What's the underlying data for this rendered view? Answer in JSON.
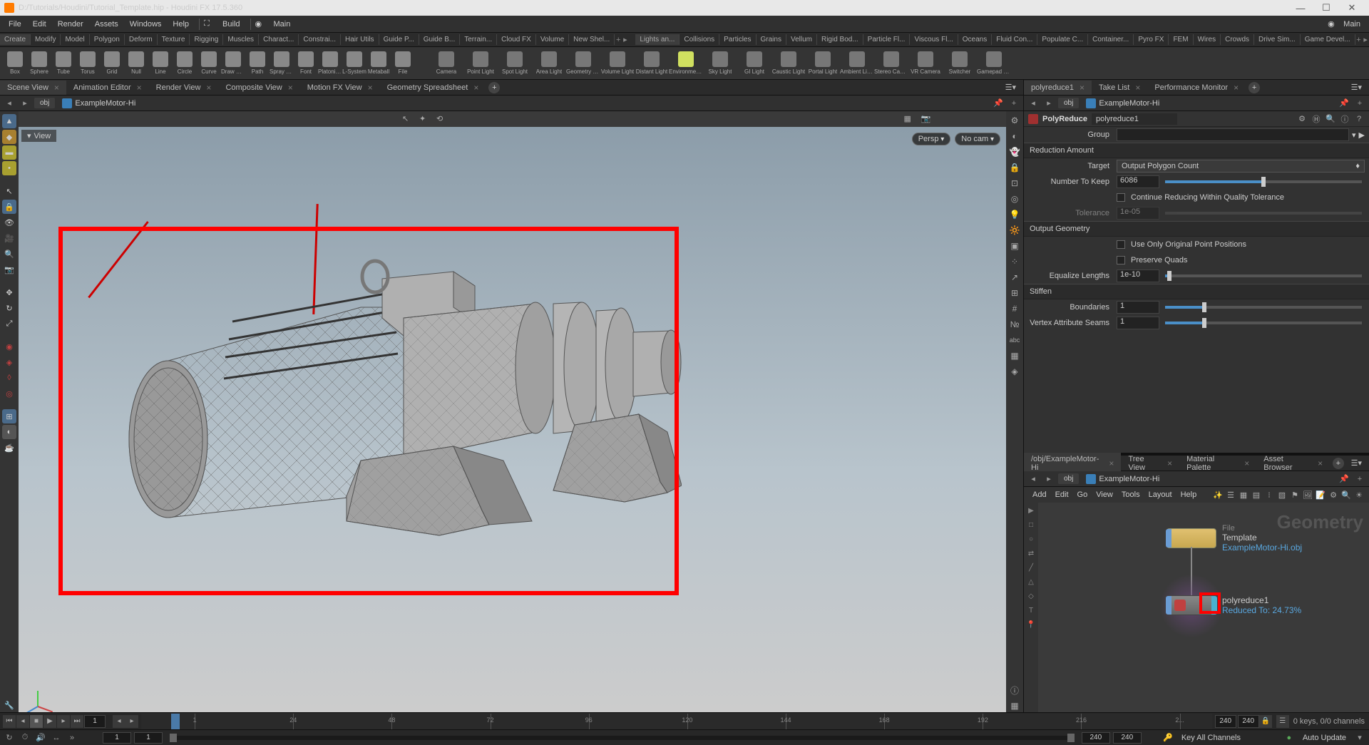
{
  "title": "D:/Tutorials/Houdini/Tutorial_Template.hip - Houdini FX 17.5.360",
  "menubar": {
    "items": [
      "File",
      "Edit",
      "Render",
      "Assets",
      "Windows",
      "Help"
    ],
    "build": "Build",
    "main": "Main"
  },
  "shelf_tabs_left": [
    "Create",
    "Modify",
    "Model",
    "Polygon",
    "Deform",
    "Texture",
    "Rigging",
    "Muscles",
    "Charact...",
    "Constrai...",
    "Hair Utils",
    "Guide P...",
    "Guide B...",
    "Terrain...",
    "Cloud FX",
    "Volume",
    "New Shel..."
  ],
  "shelf_tabs_right": [
    "Lights an...",
    "Collisions",
    "Particles",
    "Grains",
    "Vellum",
    "Rigid Bod...",
    "Particle Fl...",
    "Viscous Fl...",
    "Oceans",
    "Fluid Con...",
    "Populate C...",
    "Container...",
    "Pyro FX",
    "FEM",
    "Wires",
    "Crowds",
    "Drive Sim...",
    "Game Devel..."
  ],
  "tools_left": [
    {
      "label": "Box"
    },
    {
      "label": "Sphere"
    },
    {
      "label": "Tube"
    },
    {
      "label": "Torus"
    },
    {
      "label": "Grid"
    },
    {
      "label": "Null"
    },
    {
      "label": "Line"
    },
    {
      "label": "Circle"
    },
    {
      "label": "Curve"
    },
    {
      "label": "Draw Curve"
    },
    {
      "label": "Path"
    },
    {
      "label": "Spray Paint"
    },
    {
      "label": "Font"
    },
    {
      "label": "Platonic Solids"
    },
    {
      "label": "L-System"
    },
    {
      "label": "Metaball"
    },
    {
      "label": "File"
    }
  ],
  "tools_right": [
    {
      "label": "Camera"
    },
    {
      "label": "Point Light"
    },
    {
      "label": "Spot Light"
    },
    {
      "label": "Area Light"
    },
    {
      "label": "Geometry Light"
    },
    {
      "label": "Volume Light"
    },
    {
      "label": "Distant Light"
    },
    {
      "label": "Environment Light"
    },
    {
      "label": "Sky Light"
    },
    {
      "label": "GI Light"
    },
    {
      "label": "Caustic Light"
    },
    {
      "label": "Portal Light"
    },
    {
      "label": "Ambient Light"
    },
    {
      "label": "Stereo Camera"
    },
    {
      "label": "VR Camera"
    },
    {
      "label": "Switcher"
    },
    {
      "label": "Gamepad Camera"
    }
  ],
  "left_tabs": [
    "Scene View",
    "Animation Editor",
    "Render View",
    "Composite View",
    "Motion FX View",
    "Geometry Spreadsheet"
  ],
  "right_top_tabs": [
    "polyreduce1",
    "Take List",
    "Performance Monitor"
  ],
  "path": {
    "obj": "obj",
    "scene": "ExampleMotor-Hi"
  },
  "view": {
    "label": "View",
    "persp": "Persp",
    "nocam": "No cam"
  },
  "node": {
    "type": "PolyReduce",
    "name": "polyreduce1",
    "section_reduce": "Reduction Amount",
    "group_label": "Group",
    "group_value": "",
    "target_label": "Target",
    "target_value": "Output Polygon Count",
    "numkeep_label": "Number To Keep",
    "numkeep_value": "6086",
    "continue_label": "Continue Reducing Within Quality Tolerance",
    "tolerance_label": "Tolerance",
    "tolerance_value": "1e-05",
    "section_outgeo": "Output Geometry",
    "origpts_label": "Use Only Original Point Positions",
    "presquads_label": "Preserve Quads",
    "eqlen_label": "Equalize Lengths",
    "eqlen_value": "1e-10",
    "section_stiffen": "Stiffen",
    "boundaries_label": "Boundaries",
    "boundaries_value": "1",
    "vseams_label": "Vertex Attribute Seams",
    "vseams_value": "1"
  },
  "net_tabs": [
    "/obj/ExampleMotor-Hi",
    "Tree View",
    "Material Palette",
    "Asset Browser"
  ],
  "net_menus": [
    "Add",
    "Edit",
    "Go",
    "View",
    "Tools",
    "Layout",
    "Help"
  ],
  "net": {
    "ghost": "Geometry",
    "file_type": "File",
    "file_name": "Template",
    "file_sub": "ExampleMotor-Hi.obj",
    "poly_name": "polyreduce1",
    "poly_sub": "Reduced To: 24.73%"
  },
  "timeline": {
    "frames": [
      "1",
      "24",
      "48",
      "72",
      "96",
      "120",
      "144",
      "168",
      "192",
      "216",
      "2..."
    ],
    "start": "1",
    "end": "240",
    "range_end": "240",
    "global_end": "240"
  },
  "footer": {
    "keys": "0 keys, 0/0 channels",
    "keyall": "Key All Channels",
    "autoupdate": "Auto Update"
  },
  "menubar_right": "Main"
}
